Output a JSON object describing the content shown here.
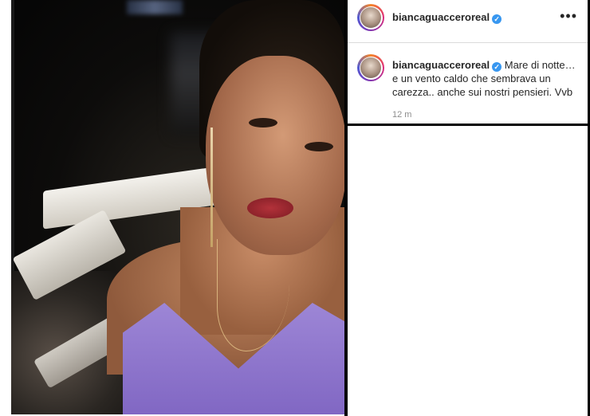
{
  "post": {
    "username": "biancaguacceroreal",
    "verified_icon": "verified-badge-icon",
    "more_icon": "more-options-icon",
    "more_glyph": "•••",
    "caption_line": "Mare di notte… e un vento caldo che sembrava un carezza.. anche sui nostri pensieri. Vvb",
    "time_ago": "12 m"
  },
  "colors": {
    "verified": "#3897f0",
    "dress": "#8f77cc",
    "text": "#262626",
    "muted": "#8e8e8e"
  }
}
